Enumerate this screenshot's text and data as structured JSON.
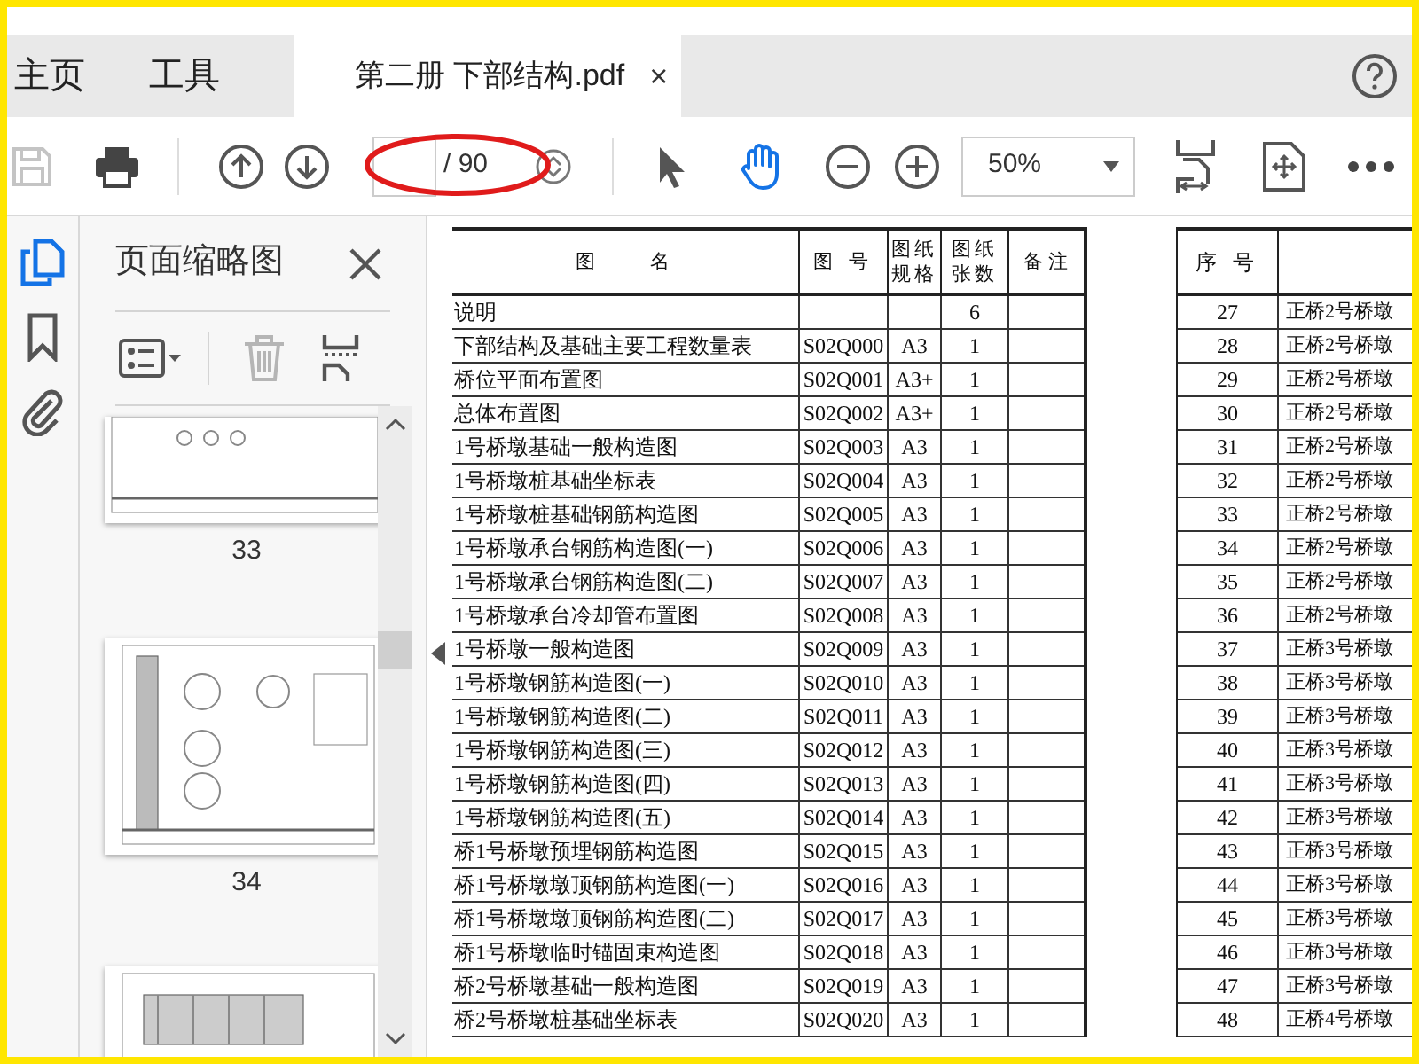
{
  "tabs": [
    {
      "kind": "home",
      "label": "主页",
      "selected": false
    },
    {
      "kind": "home",
      "label": "工具",
      "selected": false
    },
    {
      "kind": "document",
      "label": "第二册 下部结构.pdf",
      "close": "×",
      "selected": true
    }
  ],
  "toolbar": {
    "save_disabled": true,
    "page_total": "/ 90",
    "zoom": "50%",
    "tools": [
      {
        "kind": "select",
        "selected": false
      },
      {
        "kind": "hand",
        "selected": true
      }
    ]
  },
  "sidebar": {
    "panels": [
      {
        "kind": "pages",
        "selected": true
      },
      {
        "kind": "bookmarks",
        "selected": false
      },
      {
        "kind": "attachments",
        "selected": false
      }
    ],
    "title": "页面缩略图",
    "delete_disabled": true,
    "thumbnails": [
      "33",
      "34"
    ]
  },
  "document": {
    "left_table": {
      "columns": [
        "图　　名",
        "图 号",
        "图纸规格",
        "图纸张数",
        "备注"
      ],
      "rows": [
        {
          "name": "说明",
          "sheets": "6"
        },
        {
          "name": "下部结构及基础主要工程数量表",
          "number": "S02Q000",
          "size": "A3",
          "sheets": "1"
        },
        {
          "name": "桥位平面布置图",
          "number": "S02Q001",
          "size": "A3+",
          "sheets": "1"
        },
        {
          "name": "总体布置图",
          "number": "S02Q002",
          "size": "A3+",
          "sheets": "1"
        },
        {
          "name": "1号桥墩基础一般构造图",
          "number": "S02Q003",
          "size": "A3",
          "sheets": "1"
        },
        {
          "name": "1号桥墩桩基础坐标表",
          "number": "S02Q004",
          "size": "A3",
          "sheets": "1"
        },
        {
          "name": "1号桥墩桩基础钢筋构造图",
          "number": "S02Q005",
          "size": "A3",
          "sheets": "1"
        },
        {
          "name": "1号桥墩承台钢筋构造图(一)",
          "number": "S02Q006",
          "size": "A3",
          "sheets": "1"
        },
        {
          "name": "1号桥墩承台钢筋构造图(二)",
          "number": "S02Q007",
          "size": "A3",
          "sheets": "1"
        },
        {
          "name": "1号桥墩承台冷却管布置图",
          "number": "S02Q008",
          "size": "A3",
          "sheets": "1"
        },
        {
          "name": "1号桥墩一般构造图",
          "number": "S02Q009",
          "size": "A3",
          "sheets": "1"
        },
        {
          "name": "1号桥墩钢筋构造图(一)",
          "number": "S02Q010",
          "size": "A3",
          "sheets": "1"
        },
        {
          "name": "1号桥墩钢筋构造图(二)",
          "number": "S02Q011",
          "size": "A3",
          "sheets": "1"
        },
        {
          "name": "1号桥墩钢筋构造图(三)",
          "number": "S02Q012",
          "size": "A3",
          "sheets": "1"
        },
        {
          "name": "1号桥墩钢筋构造图(四)",
          "number": "S02Q013",
          "size": "A3",
          "sheets": "1"
        },
        {
          "name": "1号桥墩钢筋构造图(五)",
          "number": "S02Q014",
          "size": "A3",
          "sheets": "1"
        },
        {
          "name": "桥1号桥墩预埋钢筋构造图",
          "number": "S02Q015",
          "size": "A3",
          "sheets": "1"
        },
        {
          "name": "桥1号桥墩墩顶钢筋构造图(一)",
          "number": "S02Q016",
          "size": "A3",
          "sheets": "1"
        },
        {
          "name": "桥1号桥墩墩顶钢筋构造图(二)",
          "number": "S02Q017",
          "size": "A3",
          "sheets": "1"
        },
        {
          "name": "桥1号桥墩临时锚固束构造图",
          "number": "S02Q018",
          "size": "A3",
          "sheets": "1"
        },
        {
          "name": "桥2号桥墩基础一般构造图",
          "number": "S02Q019",
          "size": "A3",
          "sheets": "1"
        },
        {
          "name": "桥2号桥墩桩基础坐标表",
          "number": "S02Q020",
          "size": "A3",
          "sheets": "1"
        }
      ]
    },
    "right_table": {
      "columns": [
        "序 号"
      ],
      "rows": [
        {
          "no": "27",
          "name": "正桥2号桥墩"
        },
        {
          "no": "28",
          "name": "正桥2号桥墩"
        },
        {
          "no": "29",
          "name": "正桥2号桥墩"
        },
        {
          "no": "30",
          "name": "正桥2号桥墩"
        },
        {
          "no": "31",
          "name": "正桥2号桥墩"
        },
        {
          "no": "32",
          "name": "正桥2号桥墩"
        },
        {
          "no": "33",
          "name": "正桥2号桥墩"
        },
        {
          "no": "34",
          "name": "正桥2号桥墩"
        },
        {
          "no": "35",
          "name": "正桥2号桥墩"
        },
        {
          "no": "36",
          "name": "正桥2号桥墩"
        },
        {
          "no": "37",
          "name": "正桥3号桥墩"
        },
        {
          "no": "38",
          "name": "正桥3号桥墩"
        },
        {
          "no": "39",
          "name": "正桥3号桥墩"
        },
        {
          "no": "40",
          "name": "正桥3号桥墩"
        },
        {
          "no": "41",
          "name": "正桥3号桥墩"
        },
        {
          "no": "42",
          "name": "正桥3号桥墩"
        },
        {
          "no": "43",
          "name": "正桥3号桥墩"
        },
        {
          "no": "44",
          "name": "正桥3号桥墩"
        },
        {
          "no": "45",
          "name": "正桥3号桥墩"
        },
        {
          "no": "46",
          "name": "正桥3号桥墩"
        },
        {
          "no": "47",
          "name": "正桥3号桥墩"
        },
        {
          "no": "48",
          "name": "正桥4号桥墩"
        }
      ]
    }
  }
}
